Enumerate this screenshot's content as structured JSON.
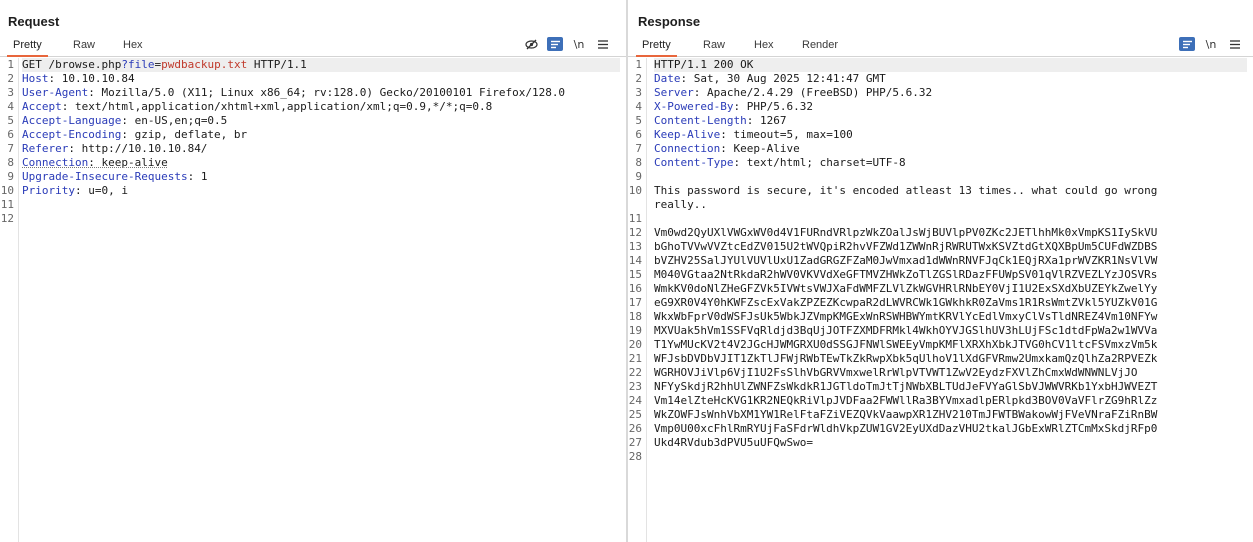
{
  "request": {
    "title": "Request",
    "tabs": [
      "Pretty",
      "Raw",
      "Hex"
    ],
    "active_tab": "Pretty",
    "toolbar": {
      "hide_icon": "eye-slash-icon",
      "wrap_icon": "message-format-icon",
      "newline_label": "\\n",
      "menu_icon": "hamburger-menu-icon"
    },
    "line_numbers": [
      "1",
      "2",
      "3",
      "4",
      "5",
      "6",
      "7",
      "8",
      "9",
      "10",
      "11",
      "12"
    ],
    "lines": {
      "l1": {
        "method": "GET",
        "path": " /browse.php",
        "q": "?",
        "param": "file",
        "eq": "=",
        "value": "pwdbackup.txt",
        "version": " HTTP/1.1"
      },
      "l2": {
        "name": "Host",
        "value": ": 10.10.10.84"
      },
      "l3": {
        "name": "User-Agent",
        "value": ": Mozilla/5.0 (X11; Linux x86_64; rv:128.0) Gecko/20100101 Firefox/128.0"
      },
      "l4": {
        "name": "Accept",
        "value": ": text/html,application/xhtml+xml,application/xml;q=0.9,*/*;q=0.8"
      },
      "l5": {
        "name": "Accept-Language",
        "value": ": en-US,en;q=0.5"
      },
      "l6": {
        "name": "Accept-Encoding",
        "value": ": gzip, deflate, br"
      },
      "l7": {
        "name": "Referer",
        "value": ": http://10.10.10.84/"
      },
      "l8": {
        "name": "Connection",
        "value": ": keep-alive"
      },
      "l9": {
        "name": "Upgrade-Insecure-Requests",
        "value": ": 1"
      },
      "l10": {
        "name": "Priority",
        "value": ": u=0, i"
      }
    }
  },
  "response": {
    "title": "Response",
    "tabs": [
      "Pretty",
      "Raw",
      "Hex",
      "Render"
    ],
    "active_tab": "Pretty",
    "toolbar": {
      "wrap_icon": "message-format-icon",
      "newline_label": "\\n",
      "menu_icon": "hamburger-menu-icon"
    },
    "line_numbers": [
      "1",
      "2",
      "3",
      "4",
      "5",
      "6",
      "7",
      "8",
      "9",
      "10",
      "",
      "11",
      "12",
      "13",
      "14",
      "15",
      "16",
      "17",
      "18",
      "19",
      "20",
      "21",
      "22",
      "23",
      "24",
      "25",
      "26",
      "27",
      "28"
    ],
    "status_line": "HTTP/1.1 200 OK",
    "headers": [
      {
        "name": "Date",
        "value": ": Sat, 30 Aug 2025 12:41:47 GMT"
      },
      {
        "name": "Server",
        "value": ": Apache/2.4.29 (FreeBSD) PHP/5.6.32"
      },
      {
        "name": "X-Powered-By",
        "value": ": PHP/5.6.32"
      },
      {
        "name": "Content-Length",
        "value": ": 1267"
      },
      {
        "name": "Keep-Alive",
        "value": ": timeout=5, max=100"
      },
      {
        "name": "Connection",
        "value": ": Keep-Alive"
      },
      {
        "name": "Content-Type",
        "value": ": text/html; charset=UTF-8"
      }
    ],
    "body_text_1": "This password is secure, it's encoded atleast 13 times.. what could go wrong",
    "body_text_2": "really..",
    "encoded": [
      "Vm0wd2QyUXlVWGxWV0d4V1FURndVRlpzWkZOalJsWjBUVlpPV0ZKc2JETlhhMk0xVmpKS1IySkVU",
      "bGhoTVVwVVZtcEdZV015U2tWVQpiR2hvVFZWd1ZWWnRjRWRUTWxKSVZtdGtXQXBpUm5CUFdWZDBS",
      "bVZHV25SalJYUlVUVlUxU1ZadGRGZFZaM0JwVmxad1dWWnRNVFJqCk1EQjRXa1prWVZKR1NsVlVW",
      "M040VGtaa2NtRkdaR2hWV0VKVVdXeGFTMVZHWkZoTlZGSlRDazFFUWpSV01qVlRZVEZLYzJOSVRs",
      "WmkKV0doNlZHeGFZVk5IVWtsVWJXaFdWMFZLVlZkWGVHRlRNbEY0VjI1U2ExSXdXbUZEYkZwelYy",
      "eG9XR0V4Y0hKWFZscExVakZPZEZKcwpaR2dLWVRCWk1GWkhkR0ZaVms1R1RsWmtZVkl5YUZkV01G",
      "WkxWbFprV0dWSFJsUk5WbkJZVmpKMGExWnRSWHBWYmtKRVlYcEdlVmxyClVsTldNREZ4Vm10NFYw",
      "MXVUak5hVm1SSFVqRldjd3BqUjJOTFZXMDFRMkl4WkhOYVJGSlhUV3hLUjFSc1dtdFpWa2w1WVVa",
      "T1YwMUcKV2t4V2JGcHJWMGRXU0dSSGJFNWlSWEEyVmpKMFlXRXhXbkJTVG0hCV1ltcFSVmxzVm5k",
      "WFJsbDVDbVJIT1ZkTlJFWjRWbTEwTkZkRwpXbk5qUlhoV1lXdGFVRmw2UmxkamQzQlhZa2RPVEZk",
      "WGRHOVJiVlp6VjI1U2FsSlhVbGRVVmxwelRrWlpVTVWT1ZwV2EydzFXVlZhCmxWdWNWNLVjJO",
      "NFYySkdjR2hhUlZWNFZsWkdkR1JGTldoTmJtTjNWbXBLTUdJeFVYaGlSbVJWWVRKb1YxbHJWVEZT",
      "Vm14elZteHcKVG1KR2NEQkRiVlpJVDFaa2FWWllRa3BYVmxadlpERlpkd3BOV0VaVFlrZG9hRlZz",
      "WkZOWFJsWnhVbXM1YW1RelFtaFZiVEZQVkVaawpXR1ZHV210TmJFWTBWakowWjFVeVNraFZiRnBW",
      "Vmp0U00xcFhlRmRYUjFaSFdrWldhVkpZUW1GV2EyUXdDazVHU2tkalJGbExWRlZTCmMxSkdjRFp0",
      "Ukd4RVdub3dPVU5uUFQwSwo="
    ]
  }
}
